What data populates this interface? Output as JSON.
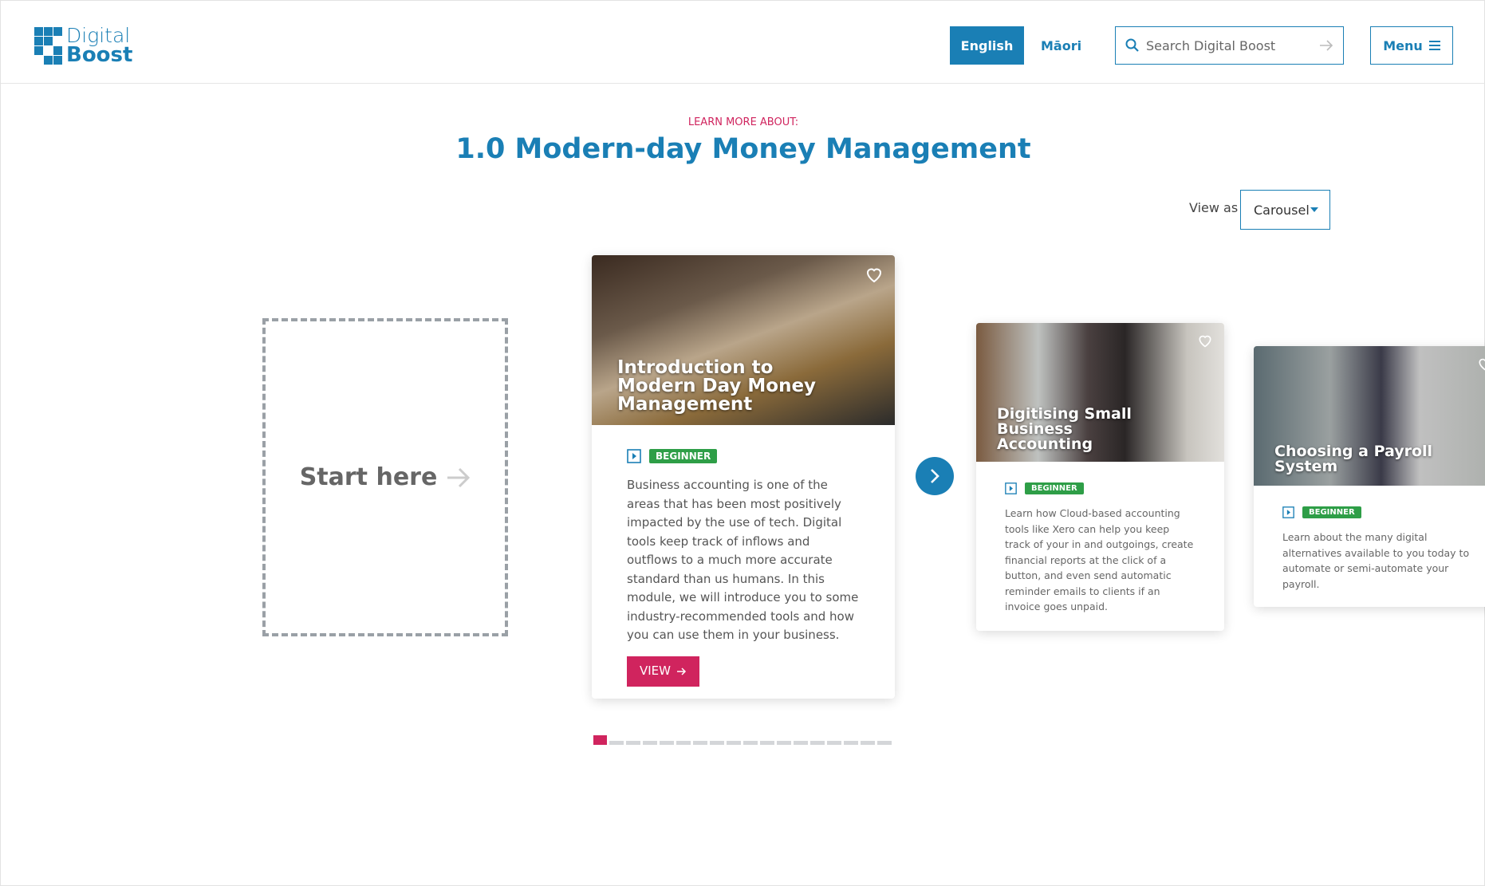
{
  "header": {
    "logo": {
      "line1": "Digital",
      "line2": "Boost"
    },
    "lang_english": "English",
    "lang_maori": "Māori",
    "search_placeholder": "Search Digital Boost",
    "menu_label": "Menu"
  },
  "page": {
    "eyebrow": "LEARN MORE ABOUT:",
    "title": "1.0 Modern-day Money Management"
  },
  "view_as": {
    "label": "View as",
    "selected": "Carousel"
  },
  "start_here": "Start here",
  "cards": [
    {
      "title": "Introduction to Modern Day Money Management",
      "badge": "BEGINNER",
      "description": "Business accounting is one of the areas that has been most positively impacted by the use of tech. Digital tools keep track of inflows and outflows to a much more accurate standard than us humans. In this module, we will introduce you to some industry-recommended tools and how you can use them in your business.",
      "button": "VIEW"
    },
    {
      "title": "Digitising Small Business Accounting",
      "badge": "BEGINNER",
      "description": "Learn how Cloud-based accounting tools like Xero can help you keep track of your in and outgoings, create financial reports at the click of a button, and even send automatic reminder emails to clients if an invoice goes unpaid."
    },
    {
      "title": "Choosing a Payroll System",
      "badge": "BEGINNER",
      "description": "Learn about the many digital alternatives available to you today to automate or semi-automate your payroll."
    }
  ],
  "pagination": {
    "total": 18,
    "current": 1
  },
  "colors": {
    "primary": "#1a7fb5",
    "accent": "#d0245e",
    "badge": "#2e9e47"
  }
}
